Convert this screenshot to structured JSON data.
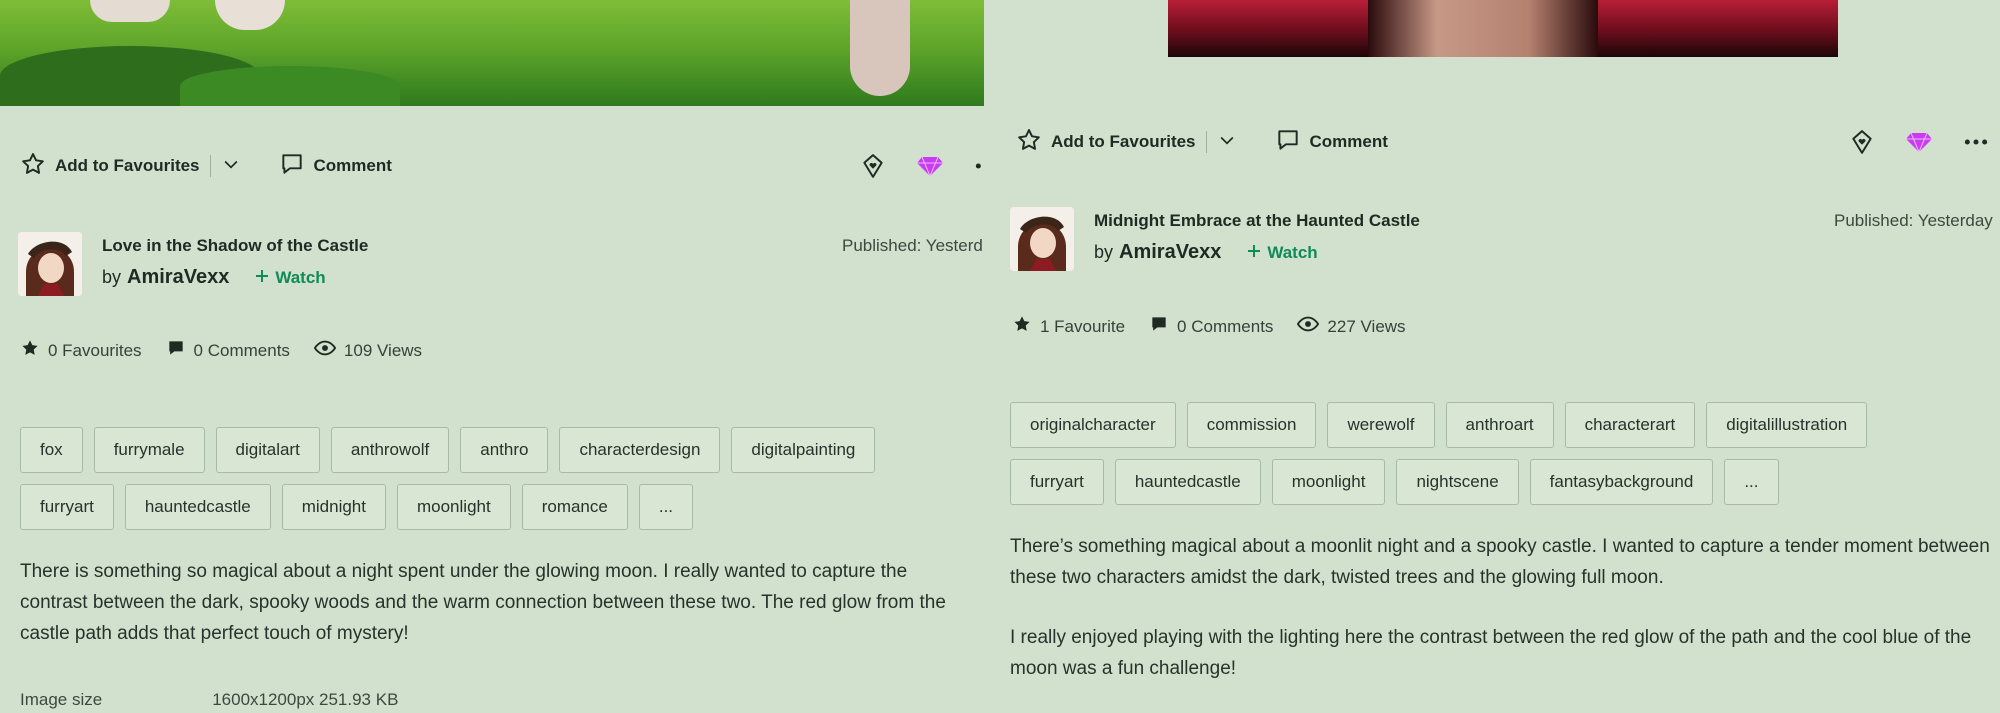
{
  "left": {
    "actions": {
      "favourite_label": "Add to Favourites",
      "comment_label": "Comment"
    },
    "deviation": {
      "title": "Love in the Shadow of the Castle",
      "by_label": "by",
      "author": "AmiraVexx",
      "watch_label": "Watch",
      "published": "Published: Yesterd"
    },
    "stats": {
      "favourites": "0 Favourites",
      "comments": "0 Comments",
      "views": "109 Views"
    },
    "tags": [
      "fox",
      "furrymale",
      "digitalart",
      "anthrowolf",
      "anthro",
      "characterdesign",
      "digitalpainting",
      "furryart",
      "hauntedcastle",
      "midnight",
      "moonlight",
      "romance",
      "..."
    ],
    "description": [
      "There is something so magical about a night spent under the glowing moon. I really wanted to capture the contrast between the dark, spooky woods and the warm connection between these two. The red glow from the castle path adds that perfect touch of mystery!"
    ],
    "image_info": {
      "label": "Image size",
      "value": "1600x1200px 251.93 KB"
    }
  },
  "right": {
    "actions": {
      "favourite_label": "Add to Favourites",
      "comment_label": "Comment"
    },
    "deviation": {
      "title": "Midnight Embrace at the Haunted Castle",
      "by_label": "by",
      "author": "AmiraVexx",
      "watch_label": "Watch",
      "published": "Published: Yesterday"
    },
    "stats": {
      "favourites": "1 Favourite",
      "comments": "0 Comments",
      "views": "227 Views"
    },
    "tags": [
      "originalcharacter",
      "commission",
      "werewolf",
      "anthroart",
      "characterart",
      "digitalillustration",
      "furryart",
      "hauntedcastle",
      "moonlight",
      "nightscene",
      "fantasybackground",
      "..."
    ],
    "description": [
      "There’s something magical about a moonlit night and a spooky castle. I wanted to capture a tender moment between these two characters amidst the dark, twisted trees and the glowing full moon.",
      "I really enjoyed playing with the lighting here the contrast between the red glow of the path and the cool blue of the moon was a fun challenge!"
    ]
  },
  "colors": {
    "background": "#d2e1cd",
    "watch": "#118a5a",
    "gem": "#c83df2",
    "text": "#1f2a24"
  },
  "icons": [
    "star-outline-icon",
    "chevron-down-icon",
    "comment-icon",
    "shield-heart-icon",
    "gem-icon",
    "more-icon",
    "star-filled-icon",
    "comment-filled-icon",
    "eye-icon",
    "plus-icon"
  ]
}
